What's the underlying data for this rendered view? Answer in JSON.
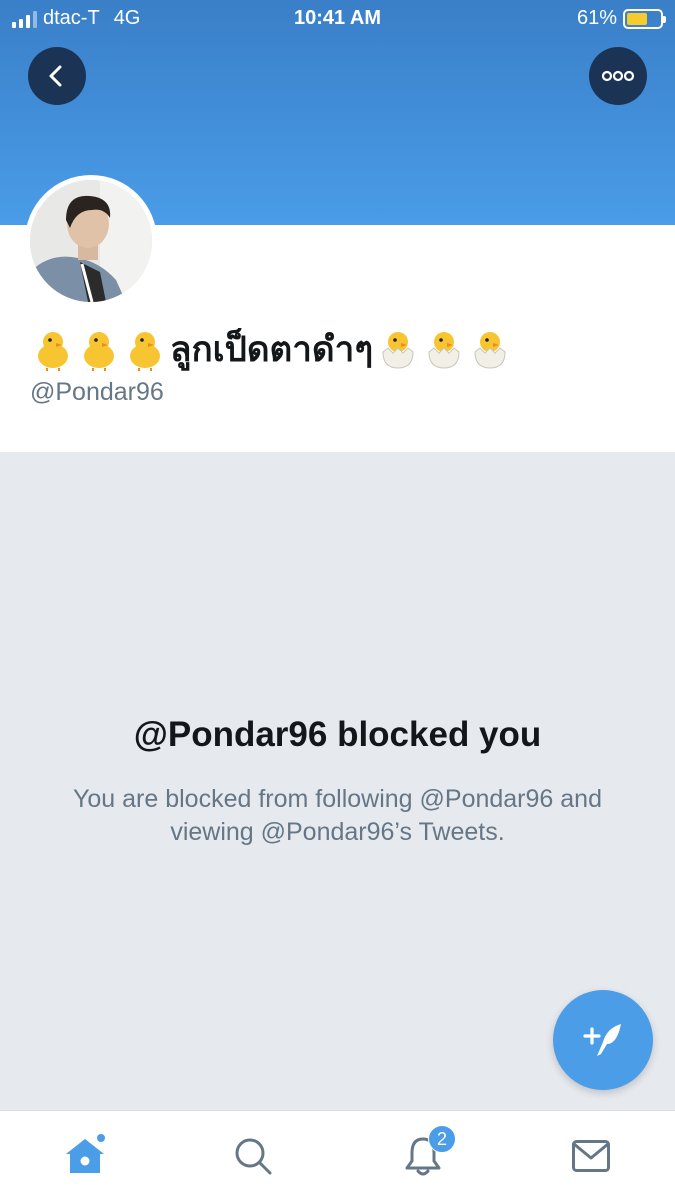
{
  "status_bar": {
    "carrier": "dtac-T",
    "network": "4G",
    "time": "10:41 AM",
    "battery_percent": "61%",
    "battery_level": 0.61,
    "signal_bars": 3
  },
  "header": {
    "back_icon": "chevron-left-icon",
    "more_icon": "ellipsis-icon"
  },
  "profile": {
    "display_name": "ลูกเป็ดตาดำๆ",
    "handle": "@Pondar96",
    "prefix_emoji": "chick-icon",
    "suffix_emoji": "hatching-chick-icon"
  },
  "blocked": {
    "title": "@Pondar96 blocked you",
    "description": "You are blocked from following @Pondar96 and viewing @Pondar96’s Tweets."
  },
  "fab": {
    "icon": "compose-tweet-icon"
  },
  "tabbar": {
    "tabs": [
      {
        "name": "home",
        "icon": "home-icon"
      },
      {
        "name": "search",
        "icon": "search-icon"
      },
      {
        "name": "notifications",
        "icon": "bell-icon"
      },
      {
        "name": "messages",
        "icon": "mail-icon"
      }
    ],
    "notification_badge": "2"
  },
  "colors": {
    "header_gradient_top": "#3a7fc8",
    "header_gradient_bottom": "#4a9ce8",
    "accent": "#4a9de6",
    "header_button_bg": "#1b3456",
    "content_bg": "#e6e9ee",
    "secondary_text": "#657786"
  }
}
